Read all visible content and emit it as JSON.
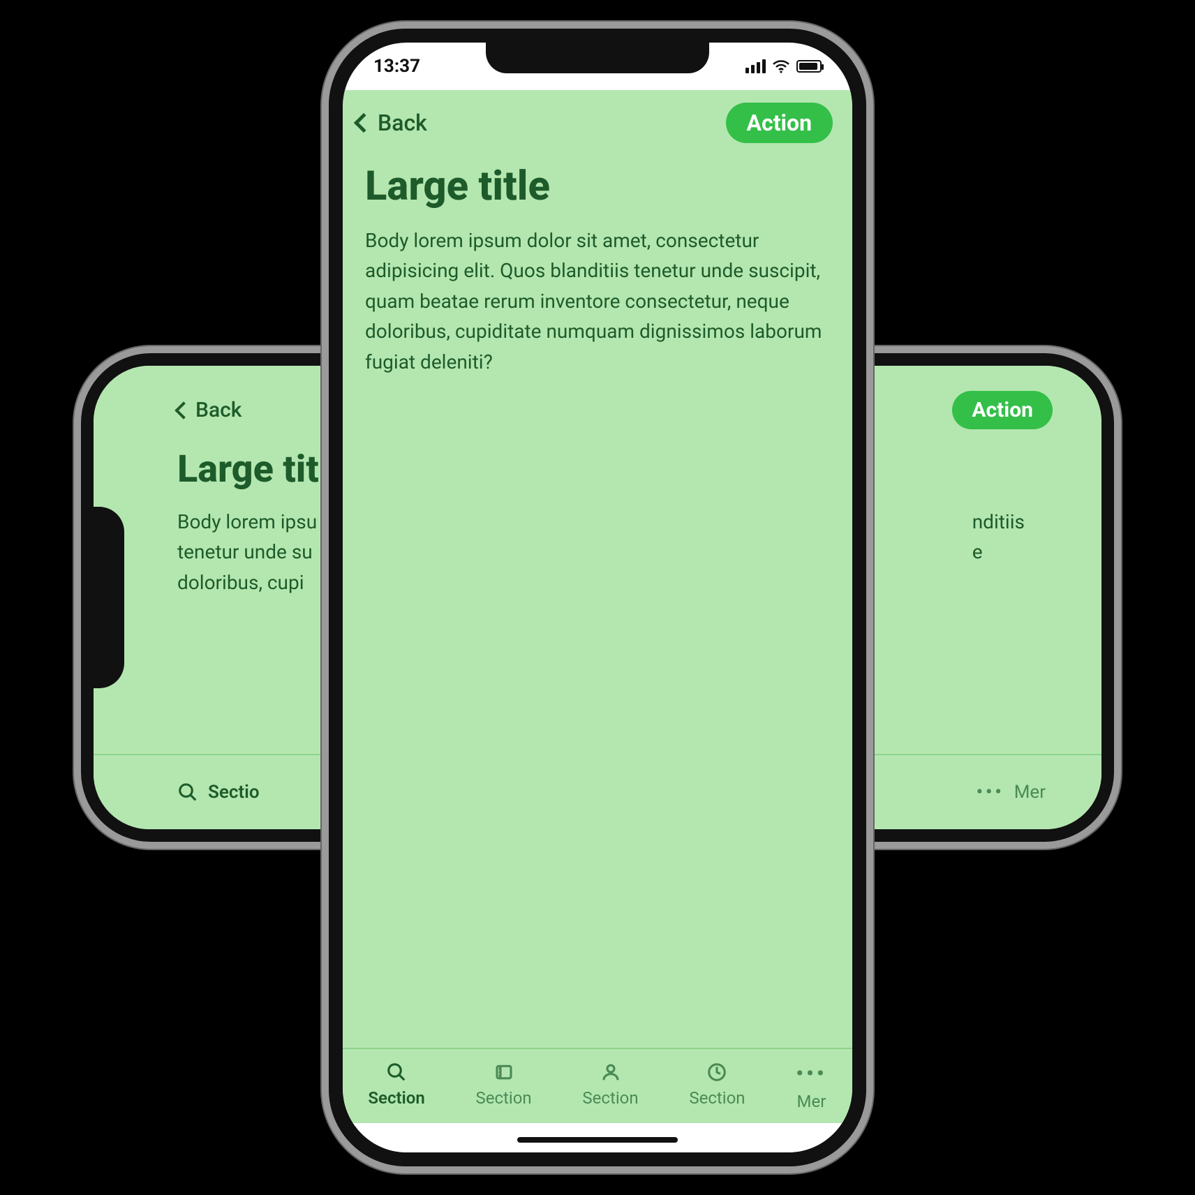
{
  "status": {
    "time": "13:37"
  },
  "nav": {
    "back_label": "Back",
    "action_label": "Action"
  },
  "page": {
    "title": "Large title",
    "body": "Body lorem ipsum dolor sit amet, consectetur adipisicing elit. Quos blanditiis tenetur unde suscipit, quam beatae rerum inventore consectetur, neque doloribus, cupiditate numquam dignissimos laborum fugiat deleniti?"
  },
  "landscape": {
    "title": "Large tit",
    "body_left": "Body lorem ipsu\ntenetur unde su\ndoloribus, cupi",
    "body_right": "nditiis\ne",
    "tab_left": "Sectio",
    "tab_right": "Mer"
  },
  "tabs": [
    {
      "label": "Section",
      "icon": "search",
      "active": true
    },
    {
      "label": "Section",
      "icon": "ticket",
      "active": false
    },
    {
      "label": "Section",
      "icon": "person",
      "active": false
    },
    {
      "label": "Section",
      "icon": "clock",
      "active": false
    },
    {
      "label": "Mer",
      "icon": "more",
      "active": false
    }
  ],
  "colors": {
    "bg": "#b4e7b0",
    "text": "#1e5b2a",
    "accent": "#34bf49"
  }
}
